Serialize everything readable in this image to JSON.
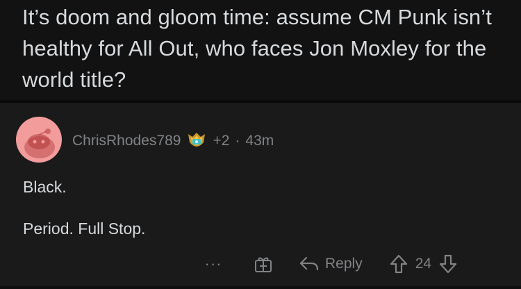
{
  "post": {
    "title": "It’s doom and gloom time: assume CM Punk isn’t healthy for All Out, who faces Jon Moxley for the world title?"
  },
  "comment": {
    "username": "ChrisRhodes789",
    "flair_icon": "trophy-shield-icon",
    "score_delta": "+2",
    "separator": "·",
    "age": "43m",
    "body_lines": [
      "Black.",
      "Period. Full Stop."
    ]
  },
  "actions": {
    "more_label": "···",
    "award_icon": "gift-box-icon",
    "reply_label": "Reply",
    "upvote_icon": "arrow-up-icon",
    "vote_count": "24",
    "downvote_icon": "arrow-down-icon"
  },
  "colors": {
    "background": "#1a1a1b",
    "header_background": "#121213",
    "text_primary": "#d7dadc",
    "text_secondary": "#818384",
    "avatar_background": "#f29c9c"
  }
}
